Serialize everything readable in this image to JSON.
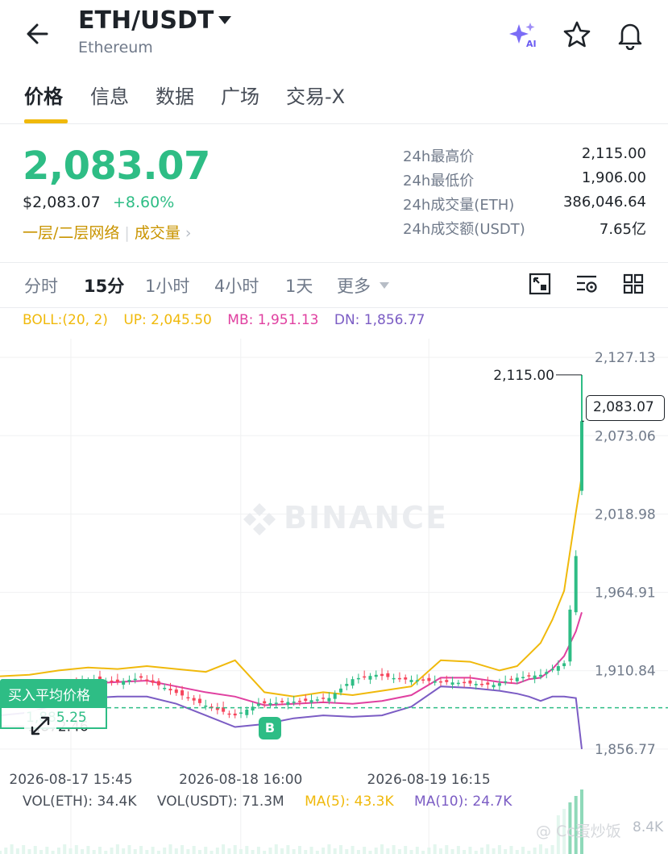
{
  "header": {
    "pair": "ETH/USDT",
    "subtitle": "Ethereum",
    "icons": [
      "back-arrow-icon",
      "ai-sparkle-icon",
      "star-icon",
      "bell-icon"
    ]
  },
  "tabs": [
    {
      "label": "价格",
      "active": true
    },
    {
      "label": "信息",
      "active": false
    },
    {
      "label": "数据",
      "active": false
    },
    {
      "label": "广场",
      "active": false
    },
    {
      "label": "交易-X",
      "active": false
    }
  ],
  "price": {
    "last": "2,083.07",
    "usd": "$2,083.07",
    "change": "+8.60%",
    "link_network": "一层/二层网络",
    "link_volume": "成交量"
  },
  "stats": [
    {
      "label": "24h最高价",
      "value": "2,115.00"
    },
    {
      "label": "24h最低价",
      "value": "1,906.00"
    },
    {
      "label": "24h成交量(ETH)",
      "value": "386,046.64"
    },
    {
      "label": "24h成交额(USDT)",
      "value": "7.65亿"
    }
  ],
  "intervals": [
    {
      "label": "分时",
      "active": false
    },
    {
      "label": "15分",
      "active": true
    },
    {
      "label": "1小时",
      "active": false
    },
    {
      "label": "4小时",
      "active": false
    },
    {
      "label": "1天",
      "active": false
    },
    {
      "label": "更多",
      "active": false
    }
  ],
  "boll": {
    "params": "BOLL:(20, 2)",
    "up": "UP: 2,045.50",
    "mb": "MB: 1,951.13",
    "dn": "DN: 1,856.77"
  },
  "overlay": {
    "avg_label": "买入平均价格",
    "avg_value": "1,885.25",
    "low_label": "1,872.46",
    "high_label": "2,115.00",
    "current_label": "2,083.07",
    "buy_marker": "B",
    "watermark": "BINANCE",
    "credit": "@ Cc蛋炒饭",
    "last_tick": "8.4K"
  },
  "volume": {
    "vol_eth": "VOL(ETH): 34.4K",
    "vol_usdt": "VOL(USDT): 71.3M",
    "ma5": "MA(5): 43.3K",
    "ma10": "MA(10): 24.7K"
  },
  "colors": {
    "up": "#2ebd85",
    "down": "#f6465d",
    "accent": "#f0b90b",
    "boll_up": "#f0b90b",
    "boll_mb": "#e040a0",
    "boll_dn": "#7b5cc4"
  },
  "chart_data": {
    "type": "line",
    "title": "",
    "xlabel": "",
    "ylabel": "",
    "y_ticks": [
      "2,127.13",
      "2,073.06",
      "2,018.98",
      "1,964.91",
      "1,910.84",
      "1,856.77"
    ],
    "x_ticks": [
      "2026-08-17 15:45",
      "2026-08-18 16:00",
      "2026-08-19 16:15"
    ],
    "ylim": [
      1845,
      2140
    ],
    "x_count": 100,
    "series": [
      {
        "name": "UP",
        "color": "#f0b90b",
        "x": [
          0,
          5,
          10,
          15,
          20,
          25,
          30,
          35,
          40,
          45,
          50,
          55,
          60,
          65,
          70,
          75,
          80,
          85,
          88,
          90,
          92,
          94,
          96,
          98,
          99
        ],
        "values": [
          1907,
          1908,
          1911,
          1913,
          1912,
          1914,
          1912,
          1910,
          1918,
          1896,
          1893,
          1896,
          1894,
          1897,
          1900,
          1918,
          1917,
          1911,
          1914,
          1922,
          1930,
          1946,
          1966,
          2020,
          2045.5
        ]
      },
      {
        "name": "MB",
        "color": "#e040a0",
        "x": [
          0,
          5,
          10,
          15,
          20,
          25,
          30,
          35,
          40,
          45,
          50,
          55,
          60,
          65,
          70,
          75,
          80,
          85,
          88,
          90,
          92,
          94,
          96,
          98,
          99
        ],
        "values": [
          1898,
          1898,
          1901,
          1902,
          1903,
          1904,
          1900,
          1896,
          1893,
          1887,
          1888,
          1889,
          1888,
          1890,
          1894,
          1906,
          1906,
          1903,
          1902,
          1905,
          1906,
          1912,
          1921,
          1938,
          1951.13
        ]
      },
      {
        "name": "DN",
        "color": "#7b5cc4",
        "x": [
          0,
          5,
          10,
          15,
          20,
          25,
          30,
          35,
          40,
          45,
          50,
          55,
          60,
          65,
          70,
          75,
          80,
          85,
          88,
          90,
          92,
          94,
          96,
          98,
          99
        ],
        "values": [
          1880,
          1882,
          1888,
          1892,
          1893,
          1893,
          1888,
          1880,
          1872,
          1874,
          1878,
          1880,
          1879,
          1880,
          1886,
          1900,
          1899,
          1897,
          1895,
          1893,
          1890,
          1893,
          1893,
          1892,
          1856.77
        ]
      }
    ],
    "candles": {
      "x": [
        0,
        4,
        8,
        12,
        16,
        20,
        24,
        28,
        32,
        36,
        40,
        44,
        48,
        52,
        56,
        60,
        64,
        68,
        72,
        76,
        80,
        84,
        88,
        92,
        96,
        98,
        99
      ],
      "close": [
        1890,
        1895,
        1898,
        1902,
        1905,
        1903,
        1906,
        1899,
        1892,
        1885,
        1880,
        1888,
        1889,
        1890,
        1892,
        1905,
        1908,
        1905,
        1904,
        1903,
        1902,
        1901,
        1906,
        1908,
        1916,
        1990,
        2083.07
      ]
    },
    "high_marker": {
      "x": 99,
      "value": 2115.0
    },
    "current_price": 2083.07,
    "buy_average": 1885.25
  }
}
